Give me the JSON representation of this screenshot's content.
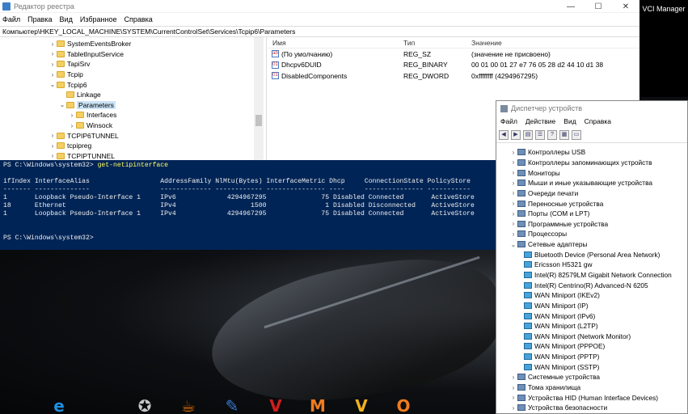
{
  "regedit": {
    "title": "Редактор реестра",
    "menu": [
      "Файл",
      "Правка",
      "Вид",
      "Избранное",
      "Справка"
    ],
    "address": "Компьютер\\HKEY_LOCAL_MACHINE\\SYSTEM\\CurrentControlSet\\Services\\Tcpip6\\Parameters",
    "tree": [
      {
        "label": "SystemEventsBroker",
        "exp": ">",
        "indent": 0
      },
      {
        "label": "TabletInputService",
        "exp": ">",
        "indent": 0
      },
      {
        "label": "TapiSrv",
        "exp": ">",
        "indent": 0
      },
      {
        "label": "Tcpip",
        "exp": ">",
        "indent": 0
      },
      {
        "label": "Tcpip6",
        "exp": "v",
        "indent": 0
      },
      {
        "label": "Linkage",
        "exp": "",
        "indent": 1
      },
      {
        "label": "Parameters",
        "exp": "v",
        "indent": 1,
        "selected": true
      },
      {
        "label": "Interfaces",
        "exp": ">",
        "indent": 2
      },
      {
        "label": "Winsock",
        "exp": ">",
        "indent": 2
      },
      {
        "label": "TCPIP6TUNNEL",
        "exp": ">",
        "indent": 0
      },
      {
        "label": "tcpipreg",
        "exp": ">",
        "indent": 0
      },
      {
        "label": "TCPIPTUNNEL",
        "exp": ">",
        "indent": 0
      }
    ],
    "columns": {
      "name": "Имя",
      "type": "Тип",
      "data": "Значение"
    },
    "values": [
      {
        "icon": "ab",
        "name": "(По умолчанию)",
        "type": "REG_SZ",
        "data": "(значение не присвоено)"
      },
      {
        "icon": "bin",
        "name": "Dhcpv6DUID",
        "type": "REG_BINARY",
        "data": "00 01 00 01 27 e7 76 05 28 d2 44 10 d1 38"
      },
      {
        "icon": "bin",
        "name": "DisabledComponents",
        "type": "REG_DWORD",
        "data": "0xffffffff (4294967295)"
      }
    ]
  },
  "vci": {
    "label": "VCI Manager"
  },
  "powershell": {
    "lines": [
      {
        "prompt": "PS C:\\Windows\\system32> ",
        "cmd": "get-netipinterface"
      },
      {
        "text": ""
      },
      {
        "text": "ifIndex InterfaceAlias                  AddressFamily NlMtu(Bytes) InterfaceMetric Dhcp     ConnectionState PolicyStore"
      },
      {
        "text": "------- --------------                  ------------- ------------ --------------- ----     --------------- -----------"
      },
      {
        "text": "1       Loopback Pseudo-Interface 1     IPv6             4294967295              75 Disabled Connected       ActiveStore"
      },
      {
        "text": "18      Ethernet                        IPv4                   1500               1 Disabled Disconnected    ActiveStore"
      },
      {
        "text": "1       Loopback Pseudo-Interface 1     IPv4             4294967295              75 Disabled Connected       ActiveStore"
      },
      {
        "text": ""
      },
      {
        "text": ""
      },
      {
        "prompt": "PS C:\\Windows\\system32> ",
        "cmd": ""
      }
    ]
  },
  "devmgr": {
    "title": "Диспетчер устройств",
    "menu": [
      "Файл",
      "Действие",
      "Вид",
      "Справка"
    ],
    "tree": [
      {
        "label": "Контроллеры USB",
        "exp": ">",
        "child": false
      },
      {
        "label": "Контроллеры запоминающих устройств",
        "exp": ">",
        "child": false
      },
      {
        "label": "Мониторы",
        "exp": ">",
        "child": false
      },
      {
        "label": "Мыши и иные указывающие устройства",
        "exp": ">",
        "child": false
      },
      {
        "label": "Очереди печати",
        "exp": ">",
        "child": false
      },
      {
        "label": "Переносные устройства",
        "exp": ">",
        "child": false
      },
      {
        "label": "Порты (COM и LPT)",
        "exp": ">",
        "child": false
      },
      {
        "label": "Программные устройства",
        "exp": ">",
        "child": false
      },
      {
        "label": "Процессоры",
        "exp": ">",
        "child": false
      },
      {
        "label": "Сетевые адаптеры",
        "exp": "v",
        "child": false
      },
      {
        "label": "Bluetooth Device (Personal Area Network)",
        "exp": "",
        "child": true
      },
      {
        "label": "Ericsson H5321 gw",
        "exp": "",
        "child": true
      },
      {
        "label": "Intel(R) 82579LM Gigabit Network Connection",
        "exp": "",
        "child": true
      },
      {
        "label": "Intel(R) Centrino(R) Advanced-N 6205",
        "exp": "",
        "child": true
      },
      {
        "label": "WAN Miniport (IKEv2)",
        "exp": "",
        "child": true
      },
      {
        "label": "WAN Miniport (IP)",
        "exp": "",
        "child": true
      },
      {
        "label": "WAN Miniport (IPv6)",
        "exp": "",
        "child": true
      },
      {
        "label": "WAN Miniport (L2TP)",
        "exp": "",
        "child": true
      },
      {
        "label": "WAN Miniport (Network Monitor)",
        "exp": "",
        "child": true
      },
      {
        "label": "WAN Miniport (PPPOE)",
        "exp": "",
        "child": true
      },
      {
        "label": "WAN Miniport (PPTP)",
        "exp": "",
        "child": true
      },
      {
        "label": "WAN Miniport (SSTP)",
        "exp": "",
        "child": true
      },
      {
        "label": "Системные устройства",
        "exp": ">",
        "child": false
      },
      {
        "label": "Тома хранилища",
        "exp": ">",
        "child": false
      },
      {
        "label": "Устройства HID (Human Interface Devices)",
        "exp": ">",
        "child": false
      },
      {
        "label": "Устройства безопасности",
        "exp": ">",
        "child": false
      }
    ]
  },
  "taskbar_icons": [
    {
      "name": "ie-icon",
      "glyph": "e",
      "color": "#1e8fe0"
    },
    {
      "name": "mercedes-icon",
      "glyph": "✪",
      "color": "#c7c7c7"
    },
    {
      "name": "java-icon",
      "glyph": "☕",
      "color": "#e76f00"
    },
    {
      "name": "tool-icon",
      "glyph": "✎",
      "color": "#3a7bd5"
    },
    {
      "name": "app-v-icon",
      "glyph": "V",
      "color": "#d11d1d"
    },
    {
      "name": "app-m-icon",
      "glyph": "M",
      "color": "#f07b1d"
    },
    {
      "name": "app-v2-icon",
      "glyph": "V",
      "color": "#f0b21d"
    },
    {
      "name": "app-o-icon",
      "glyph": "O",
      "color": "#f07b1d"
    }
  ]
}
